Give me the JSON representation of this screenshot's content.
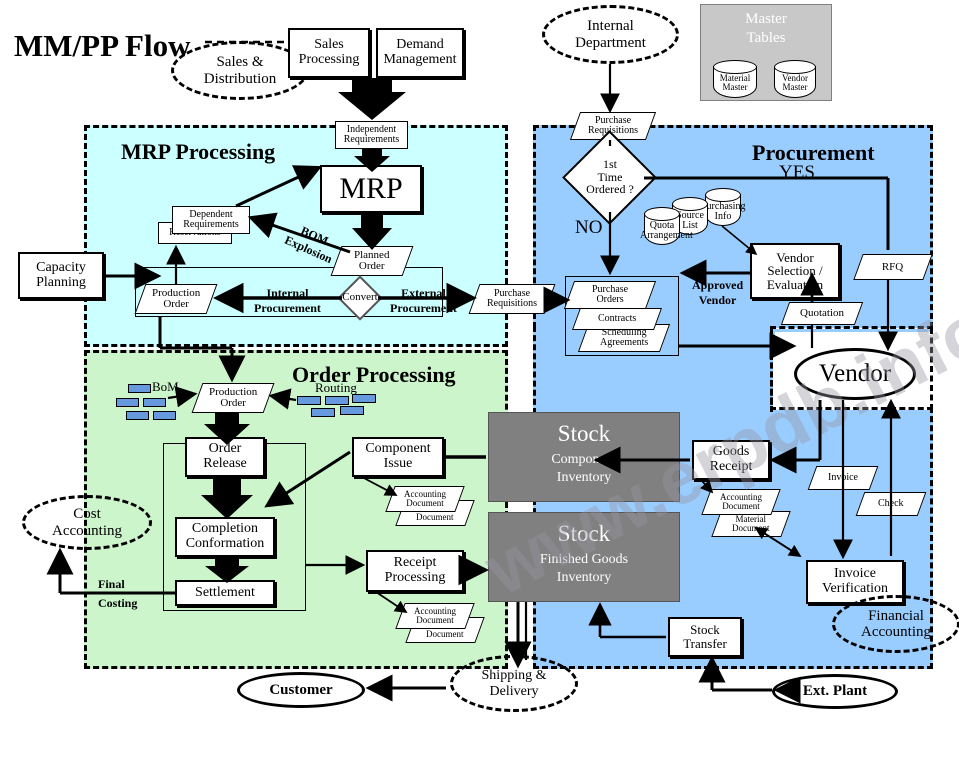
{
  "title": "MM/PP Flow",
  "watermark": "www.erpdb.info",
  "regions": {
    "mrp": {
      "title": "MRP Processing",
      "color": "#CCFFFF"
    },
    "order": {
      "title": "Order Processing",
      "color": "#CCF5CC"
    },
    "procurement": {
      "title": "Procurement",
      "color": "#99CCFF"
    }
  },
  "master_tables": {
    "title_line1": "Master",
    "title_line2": "Tables",
    "cylinders": [
      {
        "line1": "Material",
        "line2": "Master"
      },
      {
        "line1": "Vendor",
        "line2": "Master"
      }
    ]
  },
  "nodes": {
    "sales_distribution": "Sales &\nDistribution",
    "sales_processing": "Sales\nProcessing",
    "demand_management": "Demand\nManagement",
    "internal_department": "Internal\nDepartment",
    "independent_requirements": "Independent\nRequirements",
    "mrp": "MRP",
    "dependent_requirements": "Dependent\nRequirements",
    "reservations": "Reservations",
    "capacity_planning": "Capacity\nPlanning",
    "planned_order": "Planned\nOrder",
    "production_order_mrp": "Production\nOrder",
    "convert": "Convert",
    "purchase_requisitions_mrp": "Purchase\nRequisitions",
    "purchase_requisitions_proc": "Purchase\nRequisitions",
    "first_time_ordered": "1st\nTime\nOrdered ?",
    "quota_arrangement": "Quota\nArrangement",
    "source_list": "Source\nList",
    "purchasing_info": "Purchasing\nInfo",
    "vendor_selection": "Vendor\nSelection /\nEvaluation",
    "rfq": "RFQ",
    "quotation": "Quotation",
    "purchase_orders": "Purchase\nOrders",
    "contracts": "Contracts",
    "scheduling_agreements": "Scheduling\nAgreements",
    "vendor": "Vendor",
    "production_order_op": "Production\nOrder",
    "bom": "BoM",
    "routing": "Routing",
    "order_release": "Order\nRelease",
    "completion_conformation": "Completion\nConformation",
    "settlement": "Settlement",
    "component_issue": "Component\nIssue",
    "receipt_processing": "Receipt\nProcessing",
    "accounting_document": "Accounting\nDocument",
    "material_document": "Material\nDocument",
    "stock_component_title": "Stock",
    "stock_component_sub": "Component\nInventory",
    "stock_finished_title": "Stock",
    "stock_finished_sub": "Finished Goods\nInventory",
    "goods_receipt": "Goods\nReceipt",
    "invoice_doc": "Invoice",
    "check_doc": "Check",
    "invoice_verification": "Invoice\nVerification",
    "financial_accounting": "Financial\nAccounting",
    "stock_transfer": "Stock\nTransfer",
    "ext_plant": "Ext. Plant",
    "cost_accounting": "Cost\nAccounting",
    "customer": "Customer",
    "shipping_delivery": "Shipping &\nDelivery"
  },
  "edge_labels": {
    "yes": "YES",
    "no": "NO",
    "bom_explosion": "BOM\nExplosion",
    "internal_procurement": "Internal\nProcurement",
    "external_procurement": "External\nProcurement",
    "approved_vendor": "Approved\nVendor",
    "final_costing": "Final\nCosting"
  }
}
